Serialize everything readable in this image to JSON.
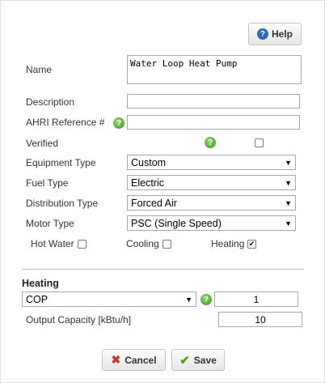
{
  "header": {
    "help_label": "Help",
    "help_icon": "?"
  },
  "form": {
    "name": {
      "label": "Name",
      "value": "Water Loop Heat Pump"
    },
    "description": {
      "label": "Description",
      "value": ""
    },
    "ahri": {
      "label": "AHRI Reference #",
      "value": "",
      "help_icon": "?"
    },
    "verified": {
      "label": "Verified",
      "checked": false,
      "help_icon": "?"
    },
    "equipment_type": {
      "label": "Equipment Type",
      "value": "Custom"
    },
    "fuel_type": {
      "label": "Fuel Type",
      "value": "Electric"
    },
    "distribution_type": {
      "label": "Distribution Type",
      "value": "Forced Air"
    },
    "motor_type": {
      "label": "Motor Type",
      "value": "PSC (Single Speed)"
    },
    "hot_water": {
      "label": "Hot Water",
      "checked": false
    },
    "cooling": {
      "label": "Cooling",
      "checked": false
    },
    "heating": {
      "label": "Heating",
      "checked": true,
      "mark": "✔"
    }
  },
  "heating_section": {
    "title": "Heating",
    "efficiency_metric": {
      "value": "COP",
      "help_icon": "?"
    },
    "efficiency_value": "1",
    "output_capacity": {
      "label": "Output Capacity [kBtu/h]",
      "value": "10"
    }
  },
  "footer": {
    "cancel_label": "Cancel",
    "save_label": "Save"
  },
  "colors": {
    "help_blue": "#2f6bb5",
    "help_green": "#4caf2a",
    "cancel_red": "#c0392b",
    "save_green": "#3fa61e"
  },
  "icons": {
    "dropdown": "▼",
    "cancel": "✖",
    "save": "✔"
  }
}
